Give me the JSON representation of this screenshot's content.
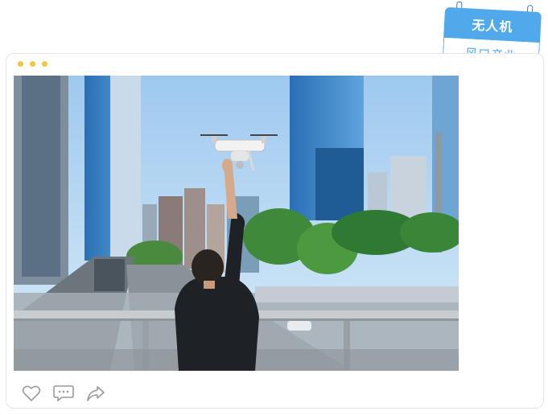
{
  "tag": {
    "title": "无人机",
    "subtitle": "风口产业"
  },
  "post": {
    "image_icon": "drone-city-photo",
    "actions": [
      {
        "icon": "heart-icon",
        "label": "like"
      },
      {
        "icon": "comment-icon",
        "label": "comment"
      },
      {
        "icon": "share-icon",
        "label": "share"
      }
    ]
  },
  "colors": {
    "accent": "#4fa9ea",
    "dot": "#f5c542",
    "card_border": "#e6e6e6",
    "icon": "#9a9a9a"
  }
}
